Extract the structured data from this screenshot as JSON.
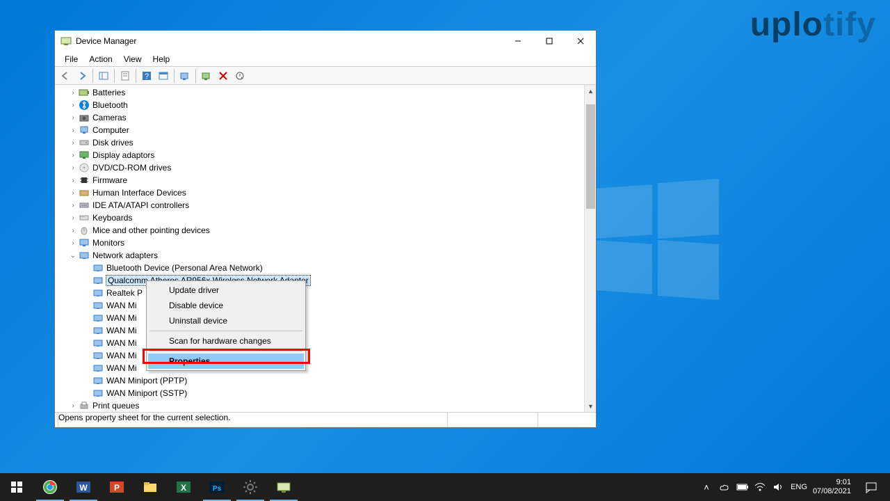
{
  "watermark": {
    "part1": "uplo",
    "part2": "tify"
  },
  "window": {
    "title": "Device Manager",
    "menu": [
      "File",
      "Action",
      "View",
      "Help"
    ],
    "status": "Opens property sheet for the current selection."
  },
  "tree": {
    "categories": [
      {
        "label": "Batteries",
        "icon": "battery"
      },
      {
        "label": "Bluetooth",
        "icon": "bt"
      },
      {
        "label": "Cameras",
        "icon": "camera"
      },
      {
        "label": "Computer",
        "icon": "pc"
      },
      {
        "label": "Disk drives",
        "icon": "disk"
      },
      {
        "label": "Display adaptors",
        "icon": "display"
      },
      {
        "label": "DVD/CD-ROM drives",
        "icon": "cd"
      },
      {
        "label": "Firmware",
        "icon": "chip"
      },
      {
        "label": "Human Interface Devices",
        "icon": "hid"
      },
      {
        "label": "IDE ATA/ATAPI controllers",
        "icon": "ide"
      },
      {
        "label": "Keyboards",
        "icon": "kb"
      },
      {
        "label": "Mice and other pointing devices",
        "icon": "mouse"
      },
      {
        "label": "Monitors",
        "icon": "monitor"
      }
    ],
    "netLabel": "Network adapters",
    "netChildren": [
      "Bluetooth Device (Personal Area Network)",
      "Qualcomm Atheros AR956x Wireless Network Adapter",
      "Realtek P",
      "WAN Mi",
      "WAN Mi",
      "WAN Mi",
      "WAN Mi",
      "WAN Mi",
      "WAN Mi",
      "WAN Miniport (PPTP)",
      "WAN Miniport (SSTP)"
    ],
    "selectedIndex": 1,
    "lastCat": "Print queues"
  },
  "context": {
    "items": [
      "Update driver",
      "Disable device",
      "Uninstall device"
    ],
    "scan": "Scan for hardware changes",
    "props": "Properties"
  },
  "taskbar": {
    "lang": "ENG",
    "time": "9:01",
    "date": "07/08/2021"
  }
}
